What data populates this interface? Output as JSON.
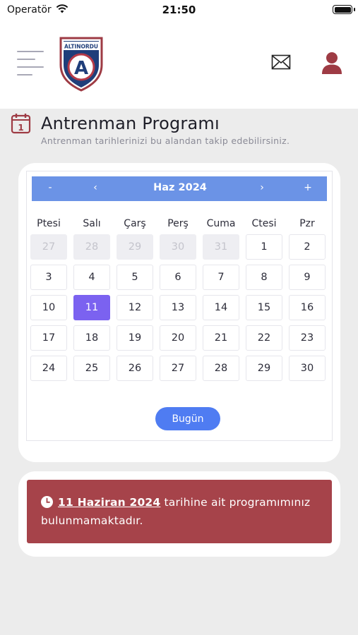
{
  "status_bar": {
    "carrier": "Operatör",
    "time": "21:50"
  },
  "header": {
    "logo_text": "ALTINORDU",
    "logo_letter": "A"
  },
  "page": {
    "title": "Antrenman Programı",
    "subtitle": "Antrenman tarihlerinizi bu alandan takip edebilirsiniz.",
    "title_icon_number": "1"
  },
  "calendar": {
    "nav": {
      "prev_year": "-",
      "prev_month": "‹",
      "month_label": "Haz 2024",
      "next_month": "›",
      "next_year": "+"
    },
    "weekdays": [
      "Ptesi",
      "Salı",
      "Çarş",
      "Perş",
      "Cuma",
      "Ctesi",
      "Pzr"
    ],
    "weeks": [
      [
        {
          "d": "27",
          "muted": true
        },
        {
          "d": "28",
          "muted": true
        },
        {
          "d": "29",
          "muted": true
        },
        {
          "d": "30",
          "muted": true
        },
        {
          "d": "31",
          "muted": true
        },
        {
          "d": "1"
        },
        {
          "d": "2"
        }
      ],
      [
        {
          "d": "3"
        },
        {
          "d": "4"
        },
        {
          "d": "5"
        },
        {
          "d": "6"
        },
        {
          "d": "7"
        },
        {
          "d": "8"
        },
        {
          "d": "9"
        }
      ],
      [
        {
          "d": "10"
        },
        {
          "d": "11",
          "selected": true
        },
        {
          "d": "12"
        },
        {
          "d": "13"
        },
        {
          "d": "14"
        },
        {
          "d": "15"
        },
        {
          "d": "16"
        }
      ],
      [
        {
          "d": "17"
        },
        {
          "d": "18"
        },
        {
          "d": "19"
        },
        {
          "d": "20"
        },
        {
          "d": "21"
        },
        {
          "d": "22"
        },
        {
          "d": "23"
        }
      ],
      [
        {
          "d": "24"
        },
        {
          "d": "25"
        },
        {
          "d": "26"
        },
        {
          "d": "27"
        },
        {
          "d": "28"
        },
        {
          "d": "29"
        },
        {
          "d": "30"
        }
      ]
    ],
    "today_label": "Bugün"
  },
  "notice": {
    "date": "11 Haziran 2024",
    "text_after_date": " tarihine ait programımınız bulunmamaktadır."
  },
  "colors": {
    "header_bar": "#6b93e6",
    "selected_day": "#7b62f0",
    "today_button": "#4f7cf2",
    "alert": "#a6434a",
    "brand_red": "#9e3b44"
  }
}
